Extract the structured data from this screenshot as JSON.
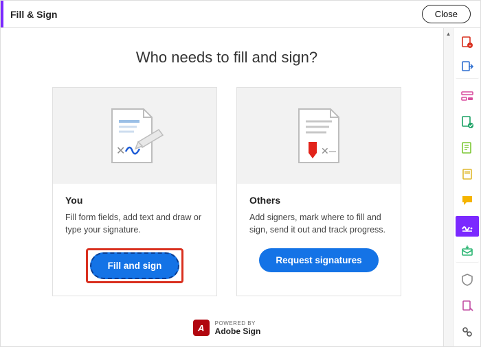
{
  "titlebar": {
    "title": "Fill & Sign",
    "close": "Close"
  },
  "heading": "Who needs to fill and sign?",
  "cards": {
    "you": {
      "title": "You",
      "desc": "Fill form fields, add text and draw or type your signature.",
      "button": "Fill and sign"
    },
    "others": {
      "title": "Others",
      "desc": "Add signers, mark where to fill and sign, send it out and track progress.",
      "button": "Request signatures"
    }
  },
  "footer": {
    "powered": "POWERED BY",
    "brand": "Adobe Sign"
  },
  "tools": [
    {
      "name": "create-pdf-icon",
      "color": "#d9301f"
    },
    {
      "name": "export-pdf-icon",
      "color": "#2f6fd0"
    },
    {
      "name": "edit-pdf-icon",
      "color": "#d94c9e"
    },
    {
      "name": "organize-pages-icon",
      "color": "#1aa164"
    },
    {
      "name": "comment-icon",
      "color": "#7cc733"
    },
    {
      "name": "scan-icon",
      "color": "#e0b92e"
    },
    {
      "name": "sticky-note-icon",
      "color": "#f5b400"
    },
    {
      "name": "fill-sign-icon",
      "color": "#ffffff",
      "active": true
    },
    {
      "name": "send-icon",
      "color": "#2cb673"
    },
    {
      "name": "protect-icon",
      "color": "#8a8a8a"
    },
    {
      "name": "stamp-icon",
      "color": "#c24ea3"
    },
    {
      "name": "more-tools-icon",
      "color": "#555555"
    }
  ],
  "colors": {
    "accent": "#7b29ff",
    "primary_button": "#1473e6",
    "highlight_box": "#d9301f"
  }
}
